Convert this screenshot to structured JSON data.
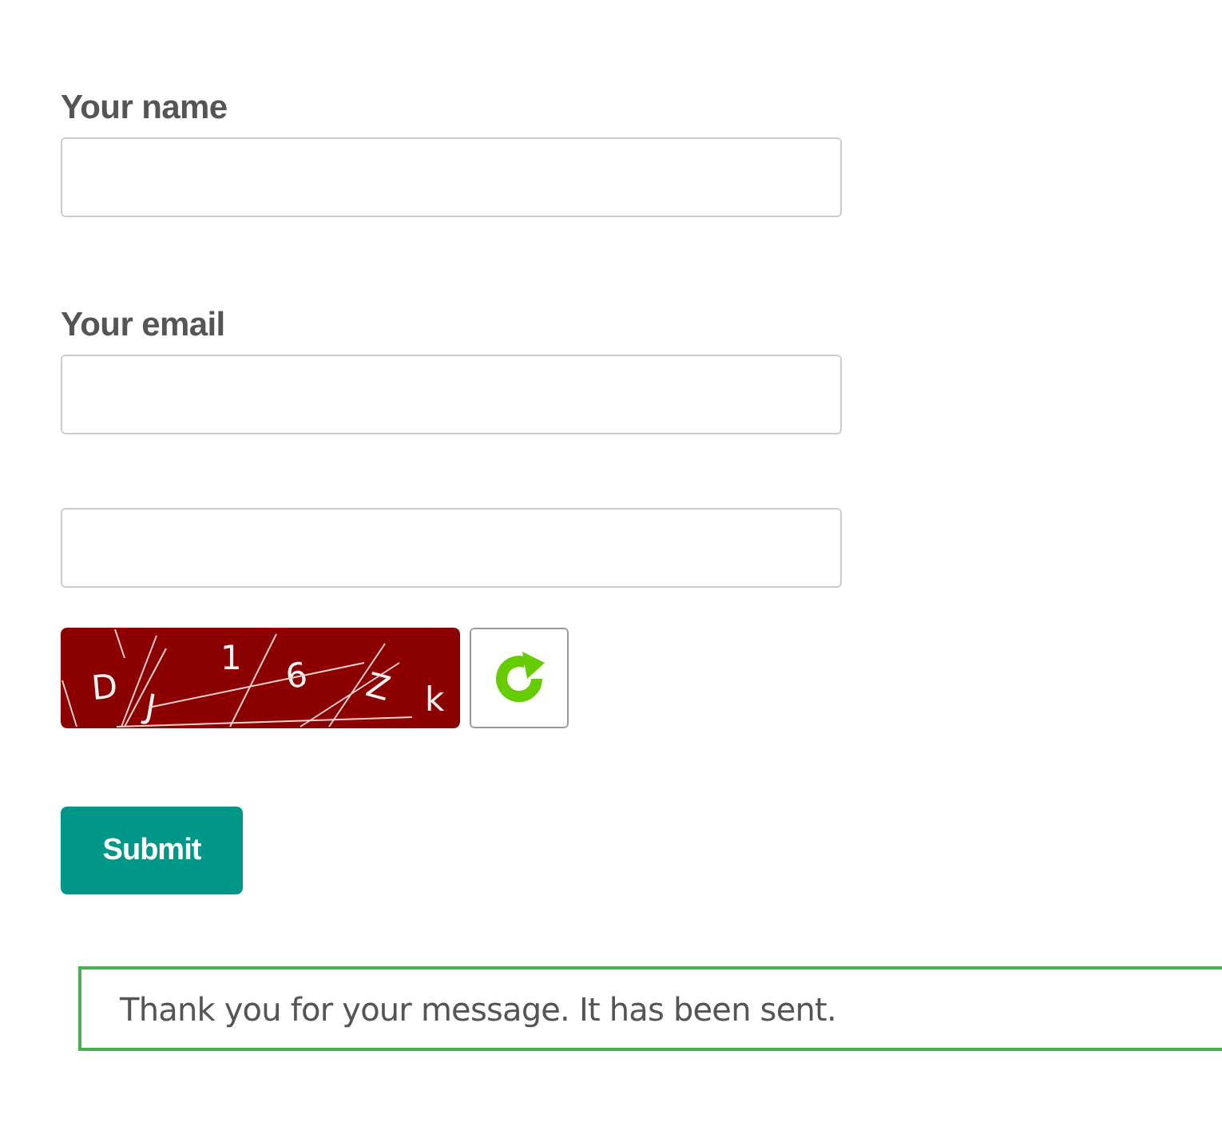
{
  "fields": [
    {
      "kind": "text",
      "label": "Your name"
    },
    {
      "kind": "text",
      "label": "Your email"
    },
    {
      "kind": "text"
    }
  ],
  "captcha": {
    "characters": [
      "D",
      "J",
      "1",
      "6",
      "Z",
      "k"
    ]
  },
  "submit": {
    "label": "Submit"
  },
  "message": {
    "text": "Thank you for your message. It has been sent."
  }
}
